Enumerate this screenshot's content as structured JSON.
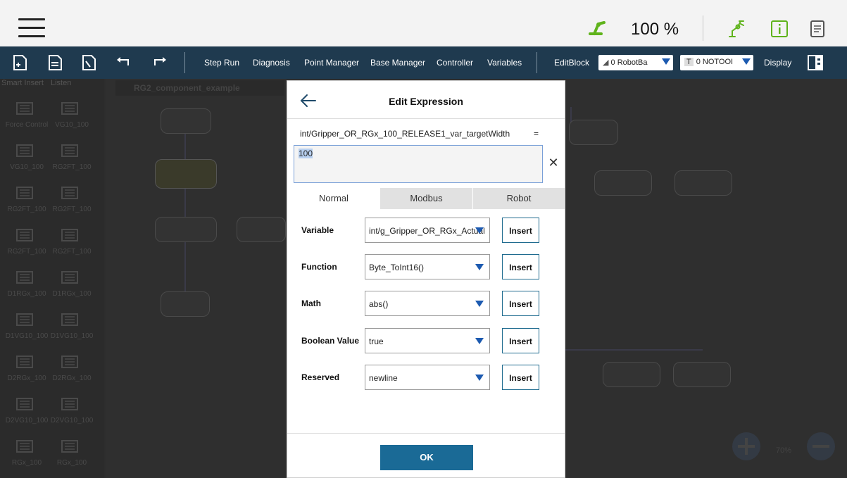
{
  "topbar": {
    "speed": "100 %",
    "icons": [
      "menu-icon",
      "speed-icon",
      "robot-arm-icon",
      "info-icon",
      "document-icon"
    ],
    "colors": {
      "accent_green": "#5fb31b",
      "background": "#f3f3f3"
    }
  },
  "toolbar": {
    "icons": [
      "new-file-icon",
      "open-file-icon",
      "save-file-icon",
      "undo-icon",
      "redo-icon"
    ],
    "items": [
      {
        "label": "Step Run"
      },
      {
        "label": "Diagnosis"
      },
      {
        "label": "Point Manager"
      },
      {
        "label": "Base Manager"
      },
      {
        "label": "Controller"
      },
      {
        "label": "Variables"
      }
    ],
    "editblock_label": "EditBlock",
    "base_select": "0 RobotBa",
    "tool_badge": "T",
    "tool_select": "0 NOTOOI",
    "display_label": "Display",
    "colors": {
      "background": "#1f3a4f"
    }
  },
  "palette": {
    "header": [
      "Smart Insert",
      "Listen"
    ],
    "items": [
      {
        "label": "Force Control"
      },
      {
        "label": "VG10_100"
      },
      {
        "label": "VG10_100"
      },
      {
        "label": "RG2FT_100"
      },
      {
        "label": "RG2FT_100"
      },
      {
        "label": "RG2FT_100"
      },
      {
        "label": "RG2FT_100"
      },
      {
        "label": "RG2FT_100"
      },
      {
        "label": "D1RGx_100"
      },
      {
        "label": "D1RGx_100"
      },
      {
        "label": "D1VG10_100"
      },
      {
        "label": "D1VG10_100"
      },
      {
        "label": "D2RGx_100"
      },
      {
        "label": "D2RGx_100"
      },
      {
        "label": "D2VG10_100"
      },
      {
        "label": "D2VG10_100"
      },
      {
        "label": "RGx_100"
      },
      {
        "label": "RGx_100"
      }
    ]
  },
  "canvas": {
    "tab_title": "RG2_component_example",
    "zoom": "70%"
  },
  "modal": {
    "title": "Edit Expression",
    "expression_name": "int/Gripper_OR_RGx_100_RELEASE1_var_targetWidth",
    "equals": "=",
    "expression_value": "100",
    "tabs": [
      {
        "label": "Normal",
        "active": true
      },
      {
        "label": "Modbus",
        "active": false
      },
      {
        "label": "Robot",
        "active": false
      }
    ],
    "rows": [
      {
        "label": "Variable",
        "value": "int/g_Gripper_OR_RGx_Actual",
        "button": "Insert"
      },
      {
        "label": "Function",
        "value": "Byte_ToInt16()",
        "button": "Insert"
      },
      {
        "label": "Math",
        "value": "abs()",
        "button": "Insert"
      },
      {
        "label": "Boolean Value",
        "value": "true",
        "button": "Insert"
      },
      {
        "label": "Reserved",
        "value": "newline",
        "button": "Insert"
      }
    ],
    "ok_label": "OK",
    "colors": {
      "ok_button": "#1a6a96",
      "caret": "#1c5ab0",
      "insert_border": "#1f6b8f"
    }
  }
}
